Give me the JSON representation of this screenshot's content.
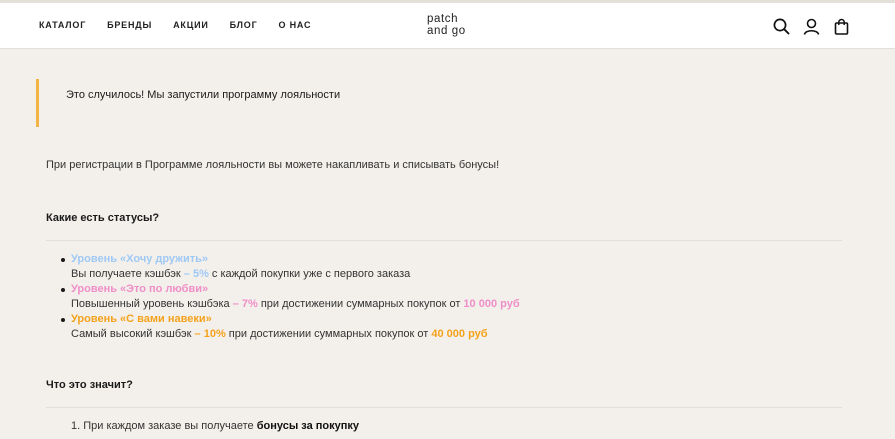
{
  "nav": [
    "КАТАЛОГ",
    "БРЕНДЫ",
    "АКЦИИ",
    "БЛОГ",
    "О НАС"
  ],
  "logo": {
    "line1": "patch",
    "line2": "and go"
  },
  "header_icons": [
    "search-icon",
    "user-icon",
    "bag-icon"
  ],
  "callout": "Это случилось! Мы запустили программу лояльности",
  "intro": "При регистрации в Программе лояльности вы можете накапливать и списывать бонусы!",
  "statuses_heading": "Какие есть статусы?",
  "levels": [
    {
      "title": "Уровень «Хочу дружить»",
      "desc_a": "Вы получаете кэшбэк",
      "cashback": " – 5%",
      "desc_b": " с каждой покупки уже с первого заказа",
      "threshold": "",
      "color": "#9fc9f5"
    },
    {
      "title": "Уровень «Это по любви»",
      "desc_a": "Повышенный уровень кэшбэка",
      "cashback": " – 7%",
      "desc_b": " при достижении суммарных покупок от ",
      "threshold": "10 000 руб",
      "color": "#f08ec8"
    },
    {
      "title": "Уровень «С вами навеки»",
      "desc_a": "Самый высокий кэшбэк",
      "cashback": " – 10%",
      "desc_b": " при достижении суммарных покупок от ",
      "threshold": "40 000 руб",
      "color": "#f4a21c"
    }
  ],
  "meaning_heading": "Что это значит?",
  "step1": {
    "text": "1. При каждом заказе вы получаете ",
    "bold": "бонусы за покупку"
  }
}
